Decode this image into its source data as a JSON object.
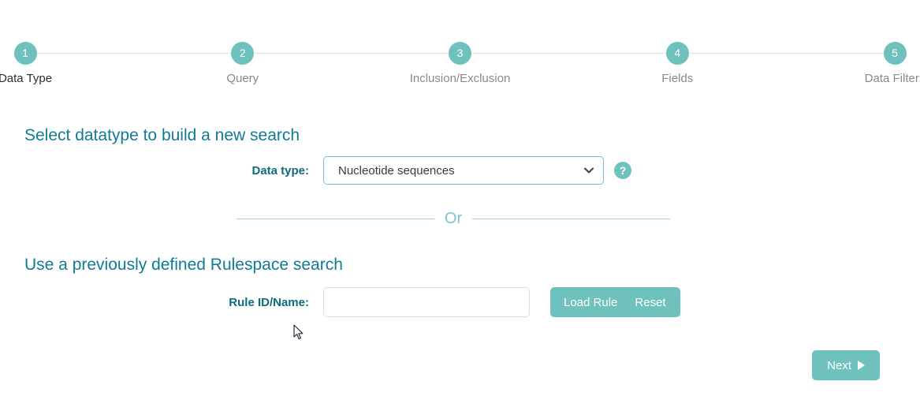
{
  "stepper": {
    "steps": [
      {
        "number": "1",
        "label": "Data Type",
        "active": true
      },
      {
        "number": "2",
        "label": "Query",
        "active": false
      },
      {
        "number": "3",
        "label": "Inclusion/Exclusion",
        "active": false
      },
      {
        "number": "4",
        "label": "Fields",
        "active": false
      },
      {
        "number": "5",
        "label": "Data Filters",
        "active": false
      }
    ]
  },
  "new_search": {
    "heading": "Select datatype to build a new search",
    "datatype_label": "Data type:",
    "datatype_value": "Nucleotide sequences",
    "datatype_options": [
      "Nucleotide sequences"
    ],
    "help_icon_glyph": "?",
    "help_icon_name": "question-mark-icon"
  },
  "divider": {
    "text": "Or"
  },
  "rulespace": {
    "heading": "Use a previously defined Rulespace search",
    "rule_label": "Rule ID/Name:",
    "rule_value": "",
    "rule_placeholder": "",
    "load_rule_label": "Load Rule",
    "reset_label": "Reset"
  },
  "footer": {
    "next_label": "Next",
    "next_icon": "play-triangle-right-icon"
  },
  "colors": {
    "teal_accent": "#6ec1bc",
    "heading_teal": "#117b93",
    "label_teal": "#0d6b7e",
    "divider_teal": "#9fd2d4",
    "or_text_teal": "#7cc3cd",
    "select_focus_border": "#7cb9e8",
    "input_border": "#dcdcdc",
    "step_line": "#e0e0e0",
    "step_label_inactive": "#8a8a8a",
    "step_label_active": "#2e2e2e"
  }
}
